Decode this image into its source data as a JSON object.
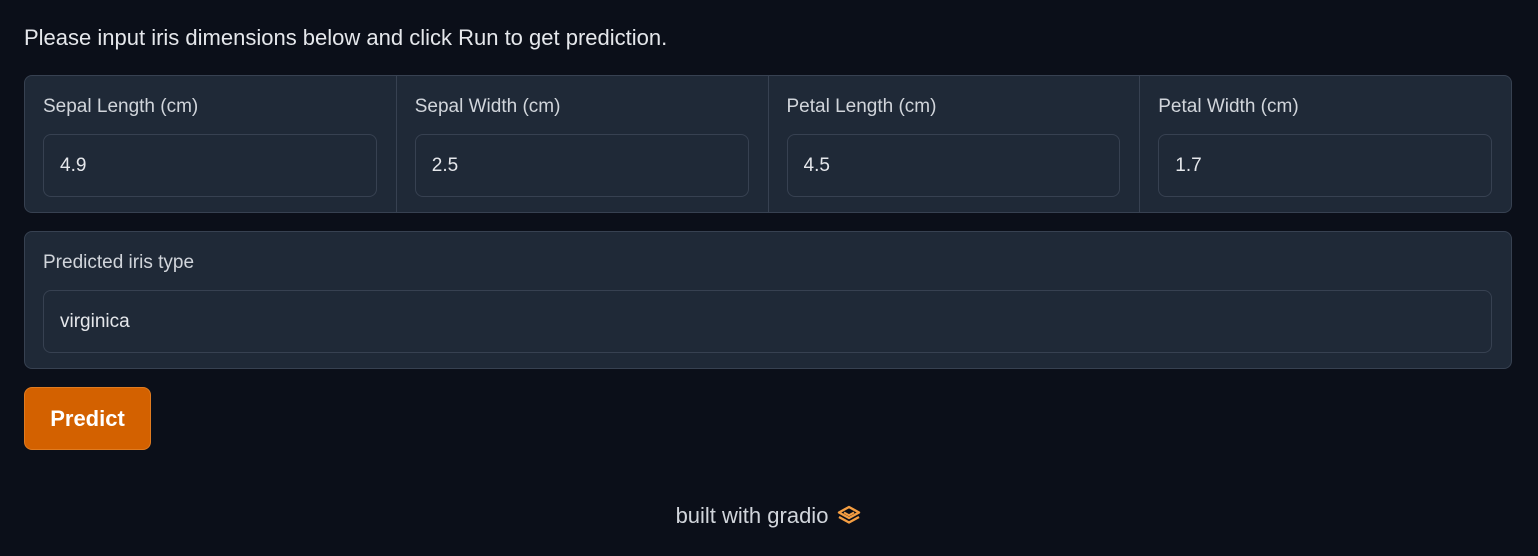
{
  "instructions": "Please input iris dimensions below and click Run to get prediction.",
  "inputs": [
    {
      "label": "Sepal Length (cm)",
      "value": "4.9"
    },
    {
      "label": "Sepal Width (cm)",
      "value": "2.5"
    },
    {
      "label": "Petal Length (cm)",
      "value": "4.5"
    },
    {
      "label": "Petal Width (cm)",
      "value": "1.7"
    }
  ],
  "output": {
    "label": "Predicted iris type",
    "value": "virginica"
  },
  "predict_button_label": "Predict",
  "footer": {
    "text": "built with gradio",
    "icon": "gradio-logo-icon"
  },
  "colors": {
    "background": "#0b0f19",
    "panel": "#1f2937",
    "accent": "#d36100"
  }
}
